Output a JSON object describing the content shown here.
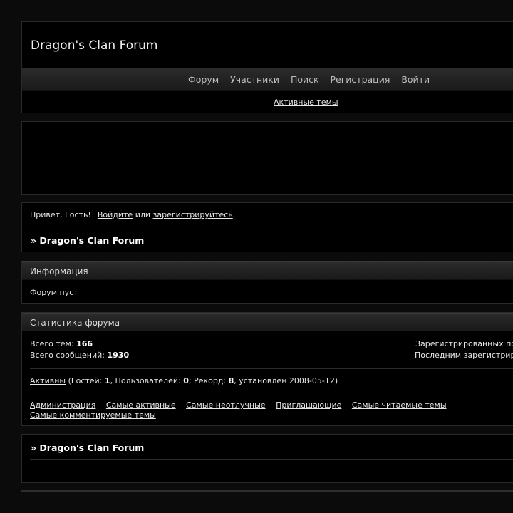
{
  "header": {
    "title": "Dragon's Clan Forum",
    "nav": [
      "Форум",
      "Участники",
      "Поиск",
      "Регистрация",
      "Войти"
    ],
    "active_topics": "Активные темы"
  },
  "welcome": {
    "greeting": "Привет, Гость!",
    "login": "Войдите",
    "or": "или",
    "register": "зарегистрируйтесь",
    "period": ".",
    "breadcrumb": "» Dragon's Clan Forum"
  },
  "info": {
    "title": "Информация",
    "text": "Форум пуст"
  },
  "stats": {
    "title": "Статистика форума",
    "topics_label": "Всего тем:",
    "topics_value": "166",
    "posts_label": "Всего сообщений:",
    "posts_value": "1930",
    "registered_label": "Зарегистрированных по",
    "last_registered_label": "Последним зарегистрир",
    "active_link": "Активны",
    "guests_label": "(Гостей:",
    "guests_value": "1",
    "users_label": ", Пользователей:",
    "users_value": "0",
    "record_label": "; Рекорд:",
    "record_value": "8",
    "record_date": ", установлен 2008-05-12)",
    "links": [
      "Администрация",
      "Самые активные",
      "Самые неотлучные",
      "Приглашающие",
      "Самые читаемые темы",
      "Самые комментируемые темы"
    ]
  },
  "footer": {
    "breadcrumb": "» Dragon's Clan Forum"
  }
}
